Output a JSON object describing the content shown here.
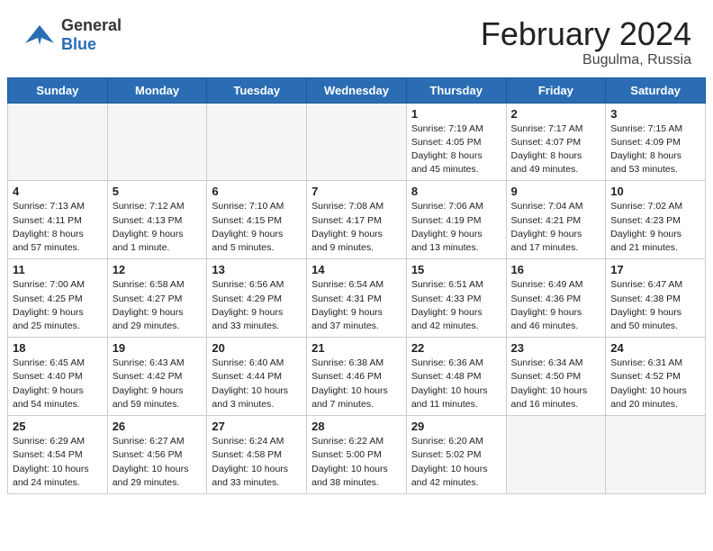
{
  "header": {
    "title": "February 2024",
    "location": "Bugulma, Russia",
    "logo_general": "General",
    "logo_blue": "Blue"
  },
  "days_of_week": [
    "Sunday",
    "Monday",
    "Tuesday",
    "Wednesday",
    "Thursday",
    "Friday",
    "Saturday"
  ],
  "weeks": [
    [
      {
        "num": "",
        "info": ""
      },
      {
        "num": "",
        "info": ""
      },
      {
        "num": "",
        "info": ""
      },
      {
        "num": "",
        "info": ""
      },
      {
        "num": "1",
        "info": "Sunrise: 7:19 AM\nSunset: 4:05 PM\nDaylight: 8 hours\nand 45 minutes."
      },
      {
        "num": "2",
        "info": "Sunrise: 7:17 AM\nSunset: 4:07 PM\nDaylight: 8 hours\nand 49 minutes."
      },
      {
        "num": "3",
        "info": "Sunrise: 7:15 AM\nSunset: 4:09 PM\nDaylight: 8 hours\nand 53 minutes."
      }
    ],
    [
      {
        "num": "4",
        "info": "Sunrise: 7:13 AM\nSunset: 4:11 PM\nDaylight: 8 hours\nand 57 minutes."
      },
      {
        "num": "5",
        "info": "Sunrise: 7:12 AM\nSunset: 4:13 PM\nDaylight: 9 hours\nand 1 minute."
      },
      {
        "num": "6",
        "info": "Sunrise: 7:10 AM\nSunset: 4:15 PM\nDaylight: 9 hours\nand 5 minutes."
      },
      {
        "num": "7",
        "info": "Sunrise: 7:08 AM\nSunset: 4:17 PM\nDaylight: 9 hours\nand 9 minutes."
      },
      {
        "num": "8",
        "info": "Sunrise: 7:06 AM\nSunset: 4:19 PM\nDaylight: 9 hours\nand 13 minutes."
      },
      {
        "num": "9",
        "info": "Sunrise: 7:04 AM\nSunset: 4:21 PM\nDaylight: 9 hours\nand 17 minutes."
      },
      {
        "num": "10",
        "info": "Sunrise: 7:02 AM\nSunset: 4:23 PM\nDaylight: 9 hours\nand 21 minutes."
      }
    ],
    [
      {
        "num": "11",
        "info": "Sunrise: 7:00 AM\nSunset: 4:25 PM\nDaylight: 9 hours\nand 25 minutes."
      },
      {
        "num": "12",
        "info": "Sunrise: 6:58 AM\nSunset: 4:27 PM\nDaylight: 9 hours\nand 29 minutes."
      },
      {
        "num": "13",
        "info": "Sunrise: 6:56 AM\nSunset: 4:29 PM\nDaylight: 9 hours\nand 33 minutes."
      },
      {
        "num": "14",
        "info": "Sunrise: 6:54 AM\nSunset: 4:31 PM\nDaylight: 9 hours\nand 37 minutes."
      },
      {
        "num": "15",
        "info": "Sunrise: 6:51 AM\nSunset: 4:33 PM\nDaylight: 9 hours\nand 42 minutes."
      },
      {
        "num": "16",
        "info": "Sunrise: 6:49 AM\nSunset: 4:36 PM\nDaylight: 9 hours\nand 46 minutes."
      },
      {
        "num": "17",
        "info": "Sunrise: 6:47 AM\nSunset: 4:38 PM\nDaylight: 9 hours\nand 50 minutes."
      }
    ],
    [
      {
        "num": "18",
        "info": "Sunrise: 6:45 AM\nSunset: 4:40 PM\nDaylight: 9 hours\nand 54 minutes."
      },
      {
        "num": "19",
        "info": "Sunrise: 6:43 AM\nSunset: 4:42 PM\nDaylight: 9 hours\nand 59 minutes."
      },
      {
        "num": "20",
        "info": "Sunrise: 6:40 AM\nSunset: 4:44 PM\nDaylight: 10 hours\nand 3 minutes."
      },
      {
        "num": "21",
        "info": "Sunrise: 6:38 AM\nSunset: 4:46 PM\nDaylight: 10 hours\nand 7 minutes."
      },
      {
        "num": "22",
        "info": "Sunrise: 6:36 AM\nSunset: 4:48 PM\nDaylight: 10 hours\nand 11 minutes."
      },
      {
        "num": "23",
        "info": "Sunrise: 6:34 AM\nSunset: 4:50 PM\nDaylight: 10 hours\nand 16 minutes."
      },
      {
        "num": "24",
        "info": "Sunrise: 6:31 AM\nSunset: 4:52 PM\nDaylight: 10 hours\nand 20 minutes."
      }
    ],
    [
      {
        "num": "25",
        "info": "Sunrise: 6:29 AM\nSunset: 4:54 PM\nDaylight: 10 hours\nand 24 minutes."
      },
      {
        "num": "26",
        "info": "Sunrise: 6:27 AM\nSunset: 4:56 PM\nDaylight: 10 hours\nand 29 minutes."
      },
      {
        "num": "27",
        "info": "Sunrise: 6:24 AM\nSunset: 4:58 PM\nDaylight: 10 hours\nand 33 minutes."
      },
      {
        "num": "28",
        "info": "Sunrise: 6:22 AM\nSunset: 5:00 PM\nDaylight: 10 hours\nand 38 minutes."
      },
      {
        "num": "29",
        "info": "Sunrise: 6:20 AM\nSunset: 5:02 PM\nDaylight: 10 hours\nand 42 minutes."
      },
      {
        "num": "",
        "info": ""
      },
      {
        "num": "",
        "info": ""
      }
    ]
  ]
}
